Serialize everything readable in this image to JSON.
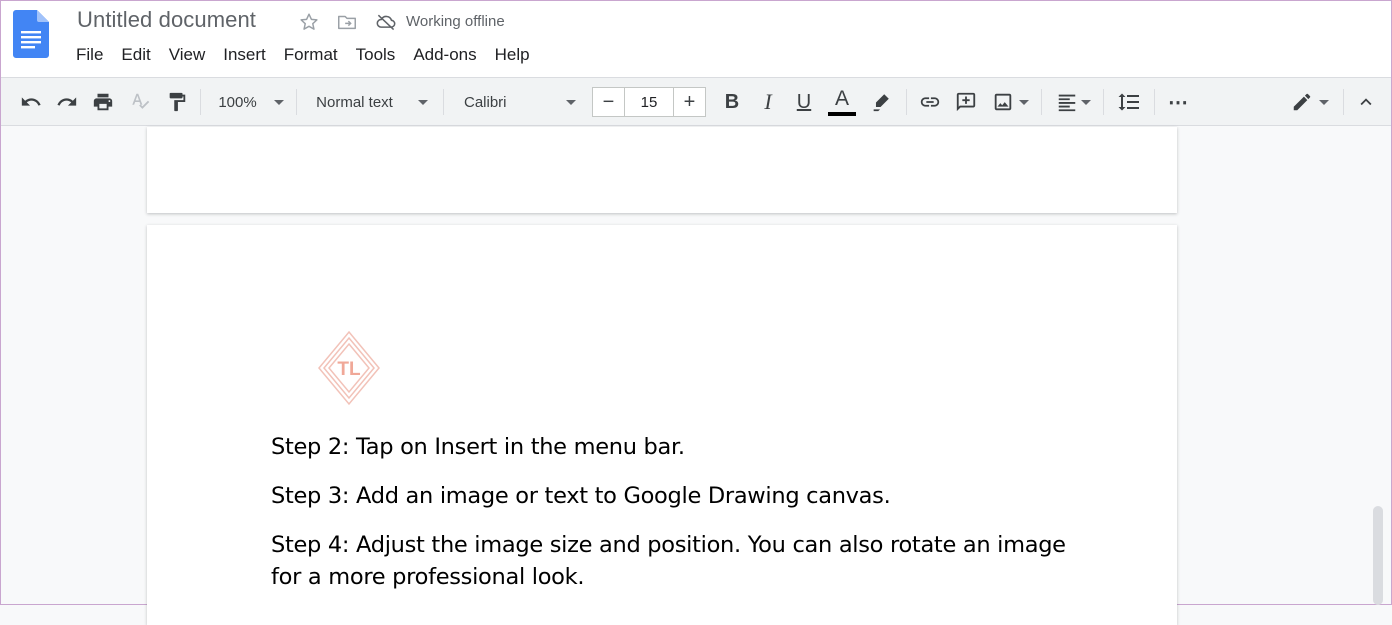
{
  "header": {
    "title": "Untitled document",
    "status": "Working offline",
    "icons": [
      "docs-logo-icon",
      "star-icon",
      "move-to-folder-icon",
      "cloud-offline-icon"
    ]
  },
  "menu": [
    "File",
    "Edit",
    "View",
    "Insert",
    "Format",
    "Tools",
    "Add-ons",
    "Help"
  ],
  "toolbar": {
    "zoom": "100%",
    "style": "Normal text",
    "font": "Calibri",
    "font_size": "15",
    "decrease": "−",
    "increase": "+",
    "bold": "B",
    "italic": "I",
    "underline": "U",
    "text_color": "A",
    "text_color_bar": "#000000",
    "more": "⋯"
  },
  "document": {
    "watermark": "TL",
    "paragraphs": [
      "Step 2: Tap on Insert in the menu bar.",
      "Step 3: Add an image or text to Google Drawing canvas.",
      "Step 4: Adjust the image size and position. You can also rotate an image",
      "for a more professional look."
    ]
  },
  "colors": {
    "docs_blue": "#4285f4",
    "icon_gray": "#5f6368",
    "watermark": "#f2b8ad"
  }
}
